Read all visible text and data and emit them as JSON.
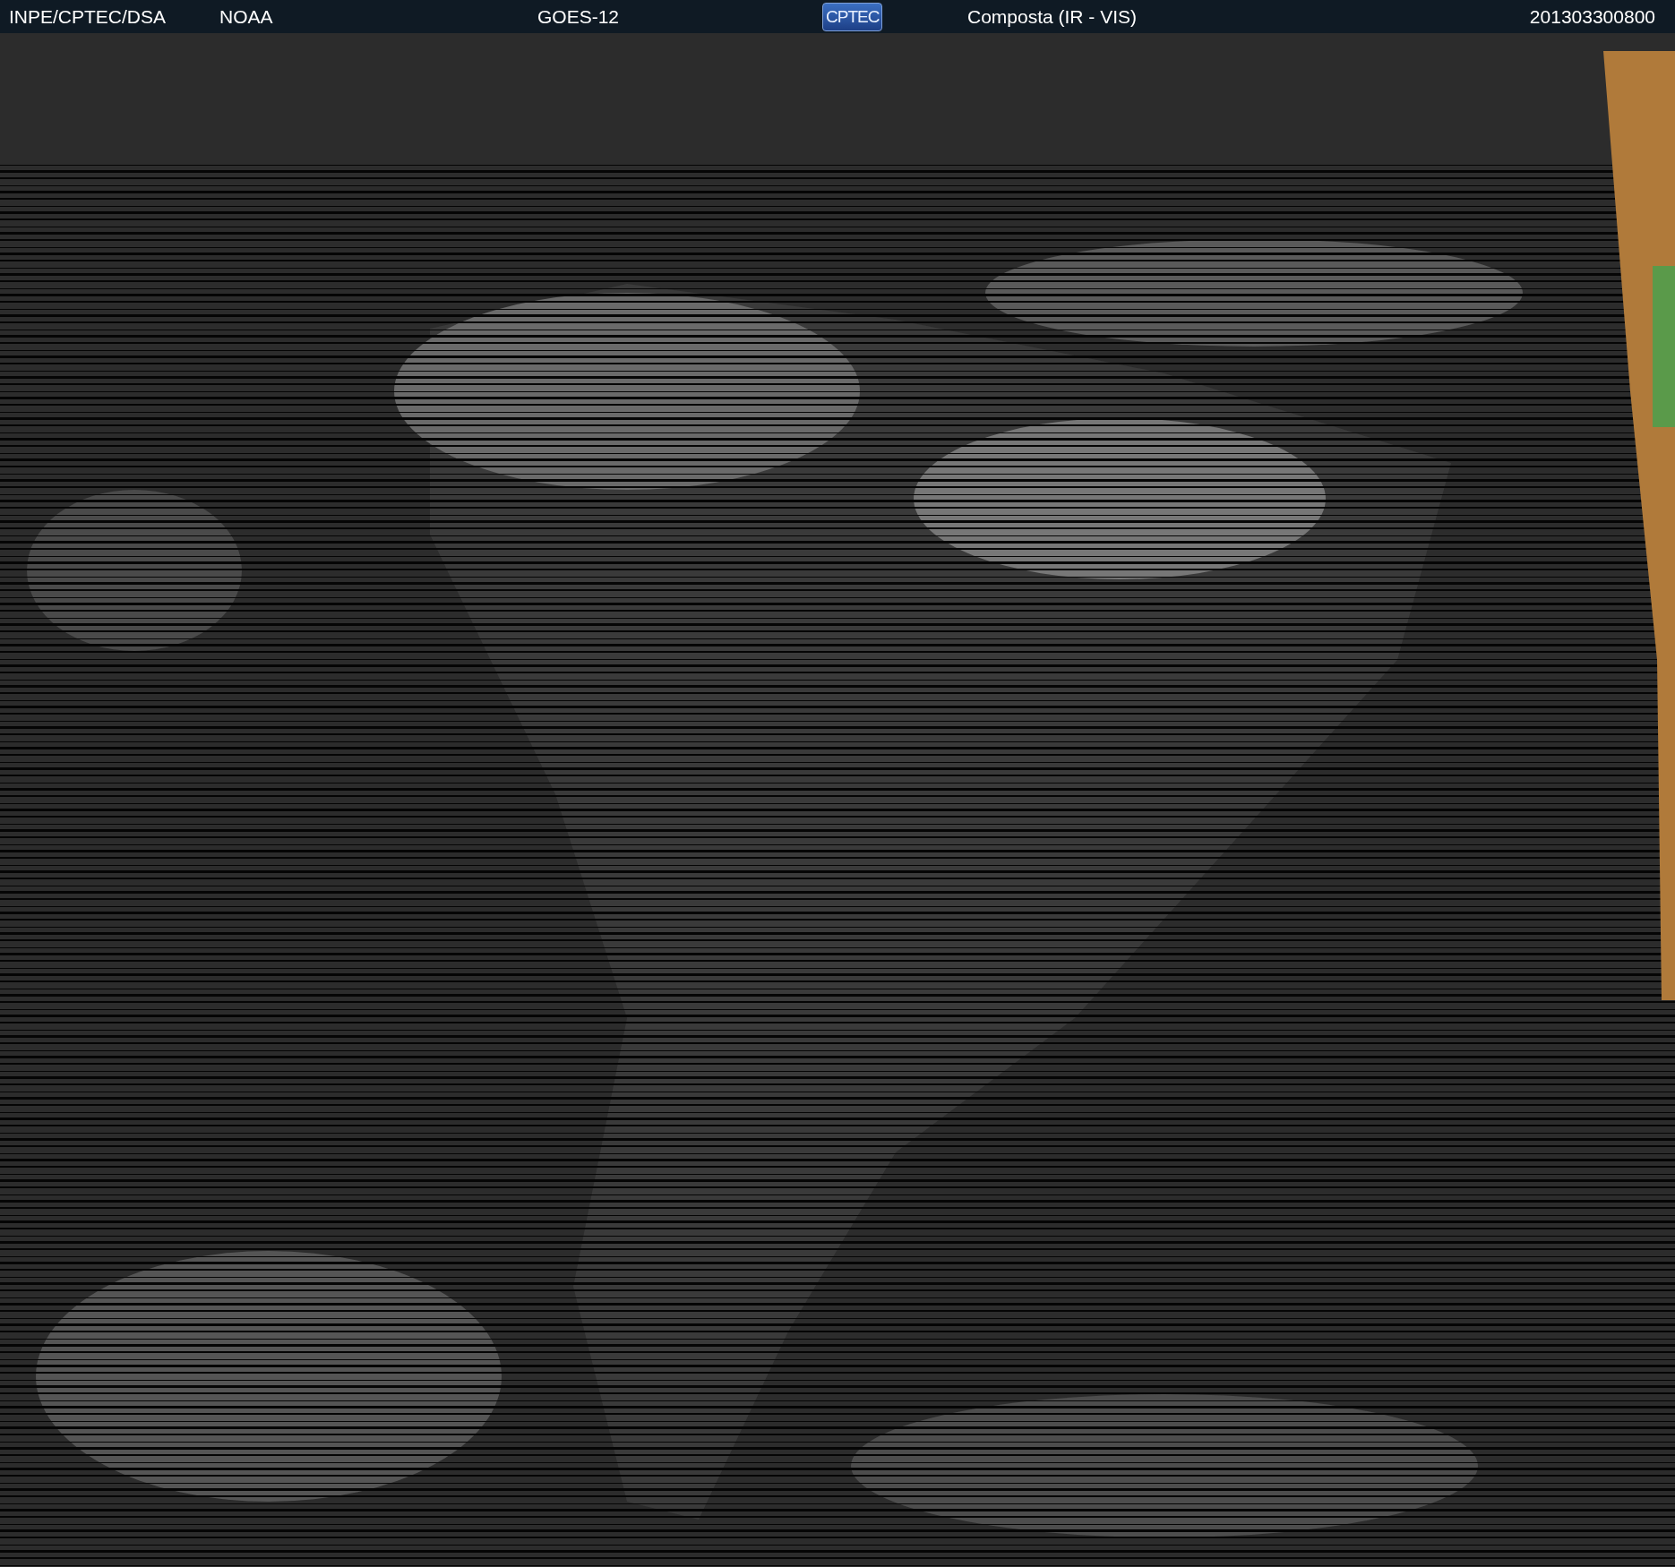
{
  "header": {
    "items": [
      {
        "kind": "text",
        "text": "INPE/CPTEC/DSA"
      },
      {
        "kind": "text",
        "text": "NOAA"
      },
      {
        "kind": "text",
        "text": "GOES-12"
      },
      {
        "kind": "logo",
        "text": "CPTEC"
      },
      {
        "kind": "text",
        "text": "Composta (IR - VIS)"
      },
      {
        "kind": "text",
        "text": "201303300800"
      }
    ]
  }
}
